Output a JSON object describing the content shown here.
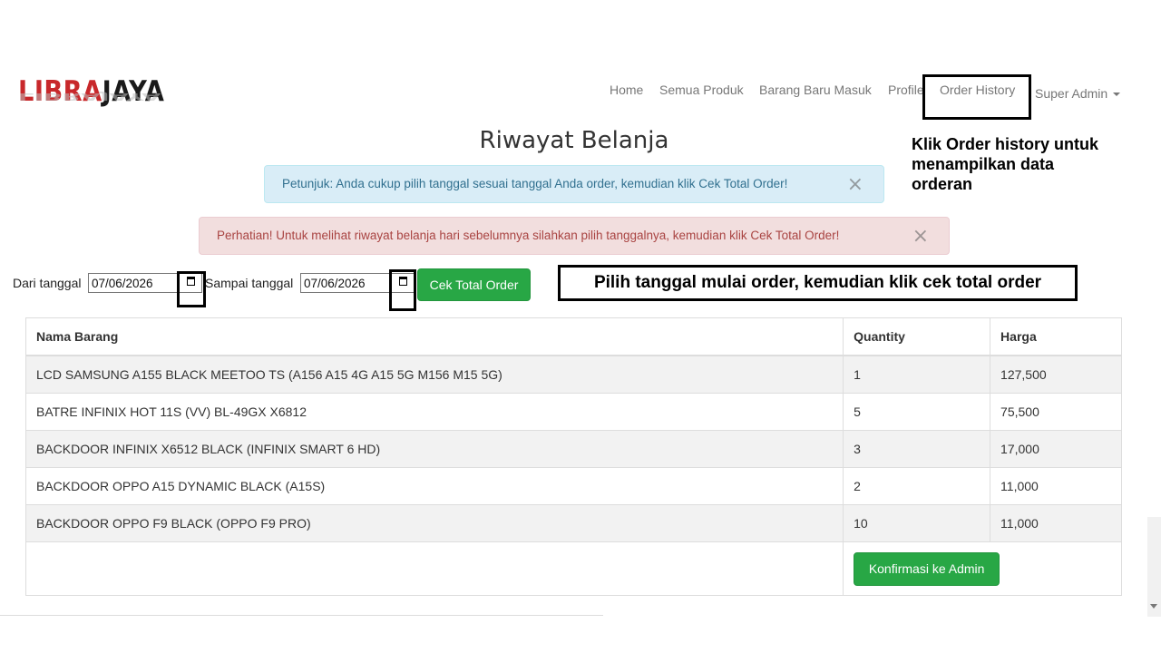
{
  "brand": {
    "logo_red": "LIBRA",
    "logo_black": "JAYA"
  },
  "nav": {
    "items": [
      "Home",
      "Semua Produk",
      "Barang Baru Masuk",
      "Profile",
      "Order History"
    ],
    "user": "Super Admin"
  },
  "page": {
    "title": "Riwayat Belanja"
  },
  "alerts": {
    "info": "Petunjuk: Anda cukup pilih tanggal sesuai tanggal Anda order, kemudian klik Cek Total Order!",
    "danger": "Perhatian! Untuk melihat riwayat belanja hari sebelumnya silahkan pilih tanggalnya, kemudian klik Cek Total Order!",
    "close_symbol": "×"
  },
  "filter": {
    "from_label": "Dari tanggal",
    "from_value": "07/06/2026",
    "to_label": "Sampai tanggal",
    "to_value": "07/06/2026",
    "button": "Cek Total Order"
  },
  "annotations": {
    "order_history_note": "Klik Order history untuk menampilkan data orderan",
    "date_note": "Pilih tanggal mulai order, kemudian klik cek total order"
  },
  "table": {
    "headers": [
      "Nama Barang",
      "Quantity",
      "Harga"
    ],
    "rows": [
      [
        "LCD SAMSUNG A155 BLACK MEETOO TS (A156 A15 4G A15 5G M156 M15 5G)",
        "1",
        "127,500"
      ],
      [
        "BATRE INFINIX HOT 11S (VV) BL-49GX X6812",
        "5",
        "75,500"
      ],
      [
        "BACKDOOR INFINIX X6512 BLACK (INFINIX SMART 6 HD)",
        "3",
        "17,000"
      ],
      [
        "BACKDOOR OPPO A15 DYNAMIC BLACK (A15S)",
        "2",
        "11,000"
      ],
      [
        "BACKDOOR OPPO F9 BLACK (OPPO F9 PRO)",
        "10",
        "11,000"
      ]
    ],
    "confirm_button": "Konfirmasi ke Admin"
  },
  "colors": {
    "success": "#28a745",
    "info_bg": "#d9edf7",
    "danger_bg": "#f2dede",
    "logo_red": "#c8282b"
  }
}
